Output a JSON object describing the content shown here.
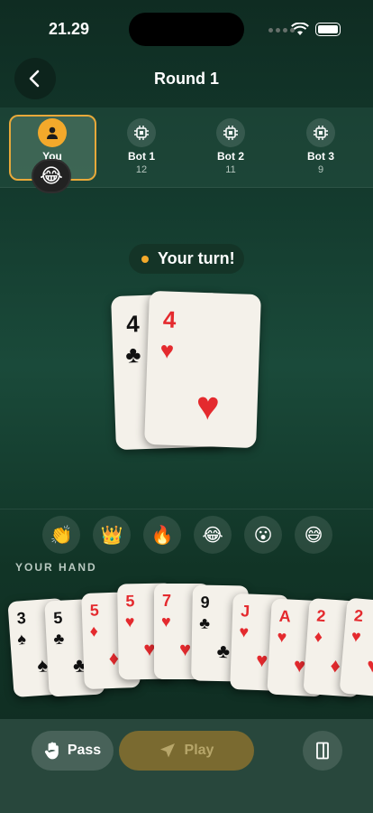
{
  "status": {
    "time": "21.29"
  },
  "header": {
    "title": "Round 1"
  },
  "players": [
    {
      "name": "You",
      "count": "",
      "icon": "person-icon"
    },
    {
      "name": "Bot 1",
      "count": "12",
      "icon": "chip-icon"
    },
    {
      "name": "Bot 2",
      "count": "11",
      "icon": "chip-icon"
    },
    {
      "name": "Bot 3",
      "count": "9",
      "icon": "chip-icon"
    }
  ],
  "you_emoji": "😂",
  "turn": {
    "text": "Your turn!"
  },
  "played": [
    {
      "rank": "4",
      "suit": "♣",
      "color": "black"
    },
    {
      "rank": "4",
      "suit": "♥",
      "color": "red"
    }
  ],
  "reactions": [
    "👏",
    "👑",
    "🔥",
    "😂",
    "😮",
    "😅"
  ],
  "hand_label": "YOUR HAND",
  "hand": [
    {
      "rank": "3",
      "suit": "♠",
      "color": "black"
    },
    {
      "rank": "5",
      "suit": "♣",
      "color": "black"
    },
    {
      "rank": "5",
      "suit": "♦",
      "color": "red"
    },
    {
      "rank": "5",
      "suit": "♥",
      "color": "red"
    },
    {
      "rank": "7",
      "suit": "♥",
      "color": "red"
    },
    {
      "rank": "9",
      "suit": "♣",
      "color": "black"
    },
    {
      "rank": "J",
      "suit": "♥",
      "color": "red"
    },
    {
      "rank": "A",
      "suit": "♥",
      "color": "red"
    },
    {
      "rank": "2",
      "suit": "♦",
      "color": "red"
    },
    {
      "rank": "2",
      "suit": "♥",
      "color": "red"
    }
  ],
  "actions": {
    "pass": "Pass",
    "play": "Play"
  },
  "colors": {
    "accent": "#f3a92b",
    "red_suit": "#e42a2e",
    "play_disabled": "#7a6a30"
  }
}
